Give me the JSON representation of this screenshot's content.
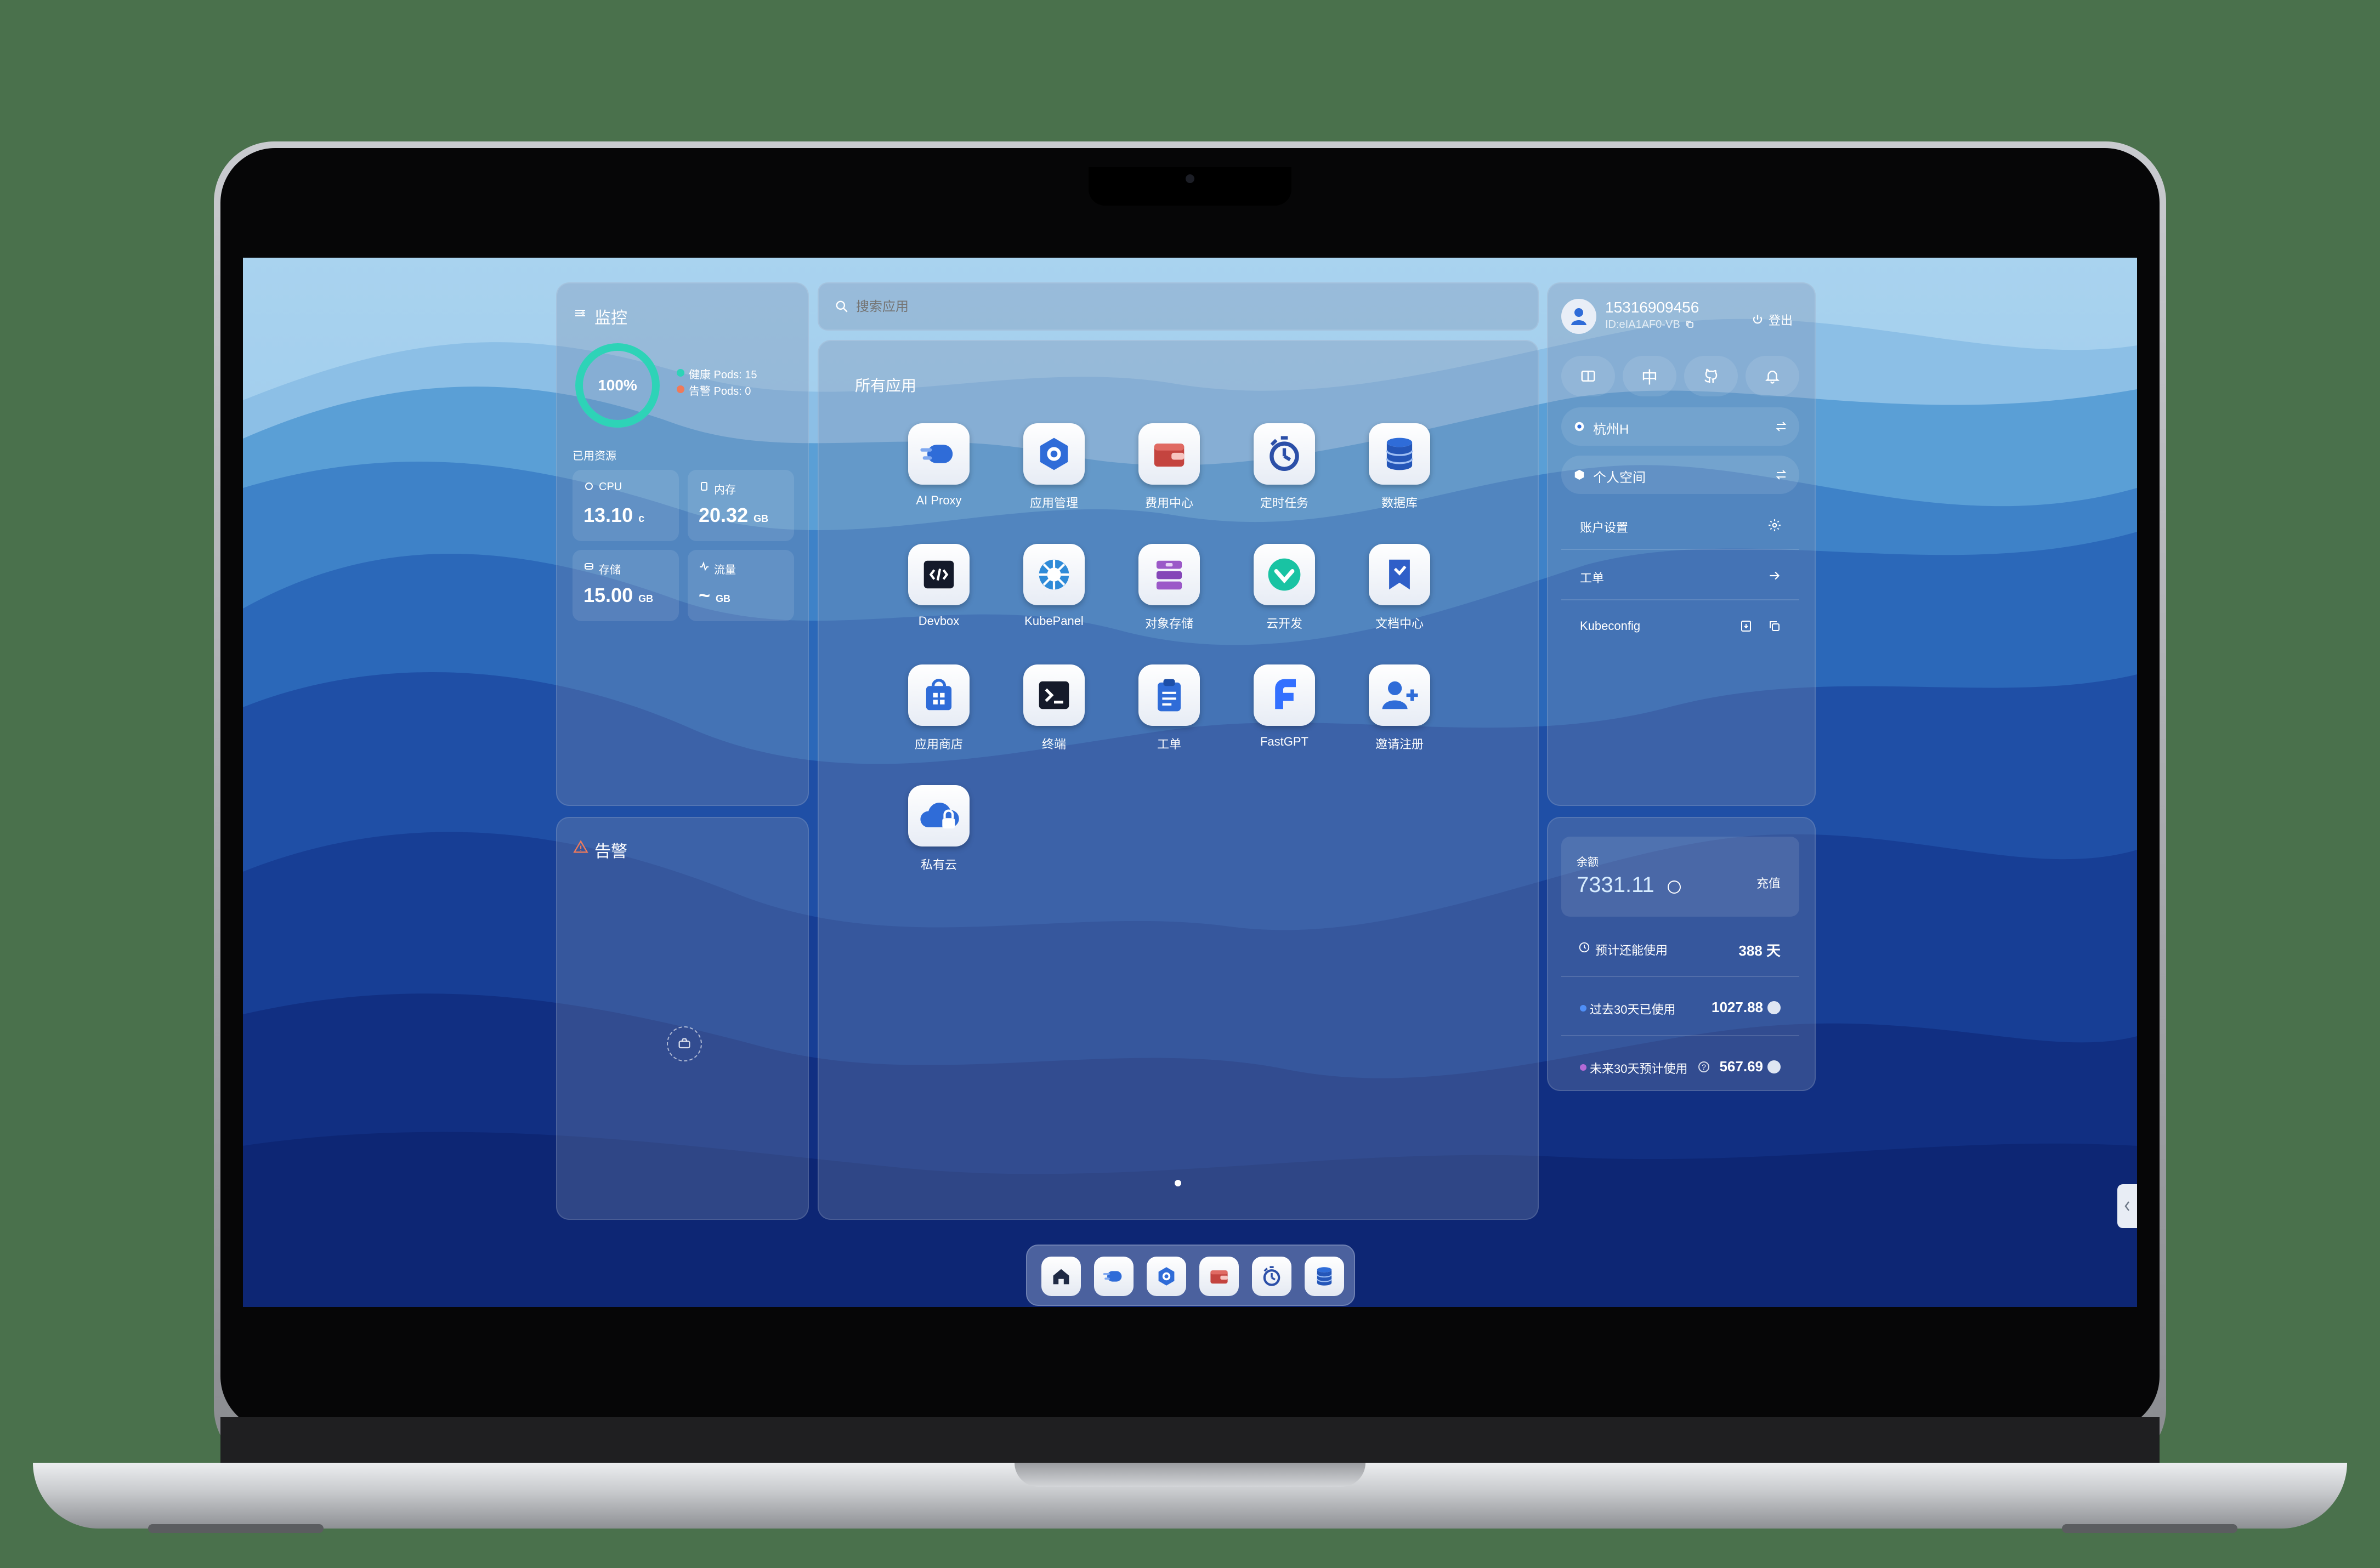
{
  "monitor": {
    "title": "监控",
    "health_percent": 1.0,
    "health_label": "100%",
    "healthy_pods": "健康 Pods: 15",
    "alert_pods": "告警 Pods: 0",
    "resources_title": "已用资源",
    "cpu": {
      "label": "CPU",
      "value": "13.10",
      "unit": "c"
    },
    "memory": {
      "label": "内存",
      "value": "20.32",
      "unit": "GB"
    },
    "storage": {
      "label": "存储",
      "value": "15.00",
      "unit": "GB"
    },
    "traffic": {
      "label": "流量",
      "value": "~",
      "unit": "GB"
    }
  },
  "alerts": {
    "title": "告警"
  },
  "search": {
    "placeholder": "搜索应用"
  },
  "apps": {
    "title": "所有应用",
    "items": [
      {
        "label": "AI Proxy",
        "icon": "ai-proxy-icon"
      },
      {
        "label": "应用管理",
        "icon": "app-management-icon"
      },
      {
        "label": "费用中心",
        "icon": "wallet-icon"
      },
      {
        "label": "定时任务",
        "icon": "timer-icon"
      },
      {
        "label": "数据库",
        "icon": "database-icon"
      },
      {
        "label": "Devbox",
        "icon": "devbox-icon"
      },
      {
        "label": "KubePanel",
        "icon": "kubepanel-icon"
      },
      {
        "label": "对象存储",
        "icon": "object-storage-icon"
      },
      {
        "label": "云开发",
        "icon": "cloud-dev-icon"
      },
      {
        "label": "文档中心",
        "icon": "docs-icon"
      },
      {
        "label": "应用商店",
        "icon": "app-store-icon"
      },
      {
        "label": "终端",
        "icon": "terminal-icon"
      },
      {
        "label": "工单",
        "icon": "ticket-icon"
      },
      {
        "label": "FastGPT",
        "icon": "fastgpt-icon"
      },
      {
        "label": "邀请注册",
        "icon": "invite-icon"
      },
      {
        "label": "私有云",
        "icon": "private-cloud-icon"
      }
    ]
  },
  "user": {
    "phone": "15316909456",
    "id": "ID:eIA1AF0-VB",
    "logout": "登出",
    "lang_button": "中",
    "region": "杭州H",
    "workspace": "个人空间",
    "menu": {
      "account_settings": "账户设置",
      "tickets": "工单",
      "kubeconfig": "Kubeconfig"
    }
  },
  "billing": {
    "balance_label": "余额",
    "balance": "7331.11",
    "recharge": "充值",
    "estimate_label": "预计还能使用",
    "estimate_value": "388 天",
    "past_label": "过去30天已使用",
    "past_value": "1027.88",
    "future_label": "未来30天预计使用",
    "future_value": "567.69"
  },
  "colors": {
    "accent": "#2ed3b7",
    "alert": "#ef7a5a",
    "past_dot": "#4f8ff7",
    "future_dot": "#b46ad6"
  },
  "dock": [
    "home-icon",
    "ai-proxy-icon",
    "app-management-icon",
    "wallet-icon",
    "timer-icon",
    "database-icon"
  ]
}
